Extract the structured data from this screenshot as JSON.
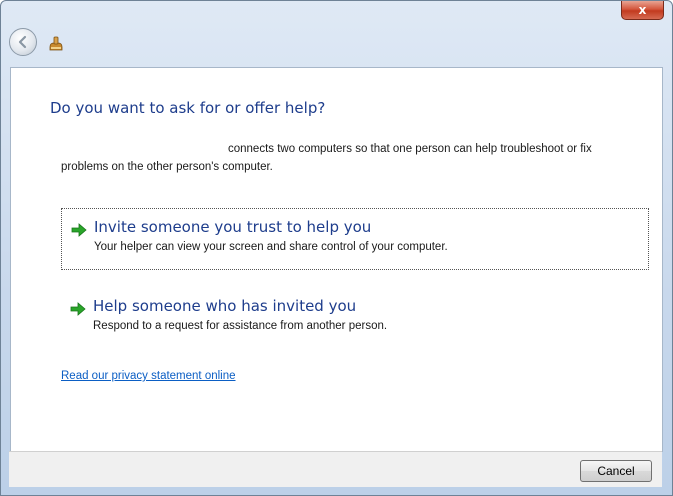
{
  "window": {
    "close_glyph": "x"
  },
  "nav": {
    "back_icon": "back-arrow-icon",
    "app_icon": "remote-assistance-icon"
  },
  "main": {
    "heading": "Do you want to ask for or offer help?",
    "description_line1": "connects two computers so that one person can help troubleshoot or fix",
    "description_line2": "problems on the other person's computer.",
    "options": [
      {
        "title": "Invite someone you trust to help you",
        "subtitle": "Your helper can view your screen and share control of your computer."
      },
      {
        "title": "Help someone who has invited you",
        "subtitle": "Respond to a request for assistance from another person."
      }
    ],
    "privacy_link": "Read our privacy statement online"
  },
  "footer": {
    "cancel_label": "Cancel"
  },
  "colors": {
    "heading": "#1e3d8c",
    "link": "#0b5ec4",
    "arrow": "#2aa52a"
  }
}
